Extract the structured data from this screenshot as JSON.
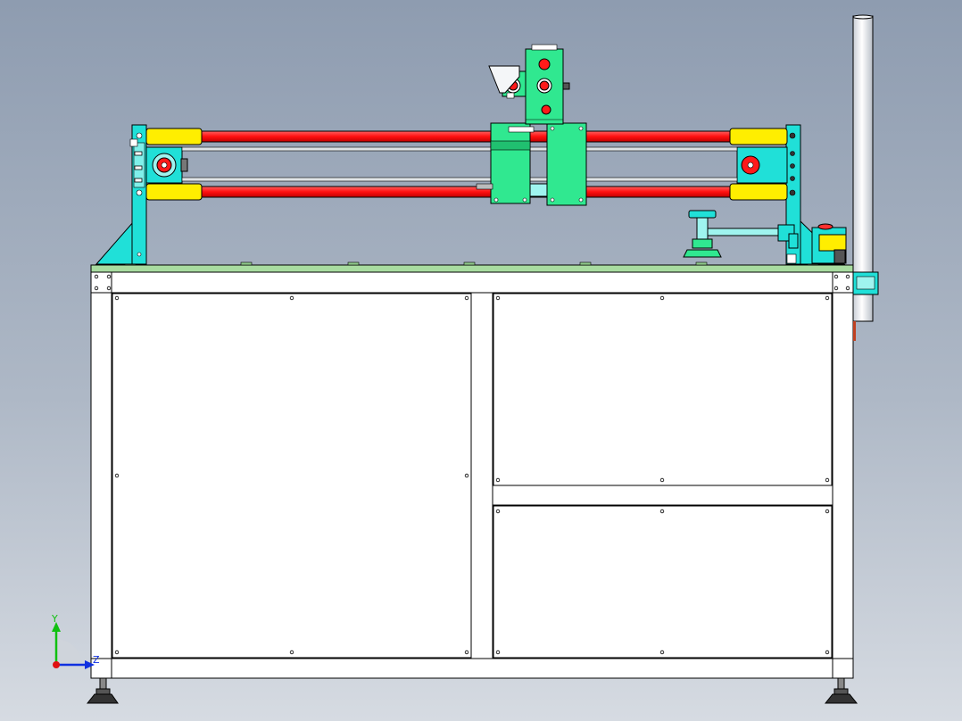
{
  "viewport": {
    "background_top": "#8e9cb0",
    "background_bottom": "#d6dbe2"
  },
  "triad": {
    "y_label": "Y",
    "z_label": "Z",
    "y_color": "#10c010",
    "z_color": "#1030e0",
    "x_color": "#e01010"
  },
  "model": {
    "rod_color": "#ff1a1a",
    "bushing_color": "#ffee00",
    "bracket_color": "#20e0d8",
    "carriage_color": "#30e890",
    "table_top_color": "#a8dca0",
    "cabinet_color": "#ffffff",
    "column_color": "#e8ecf0"
  }
}
